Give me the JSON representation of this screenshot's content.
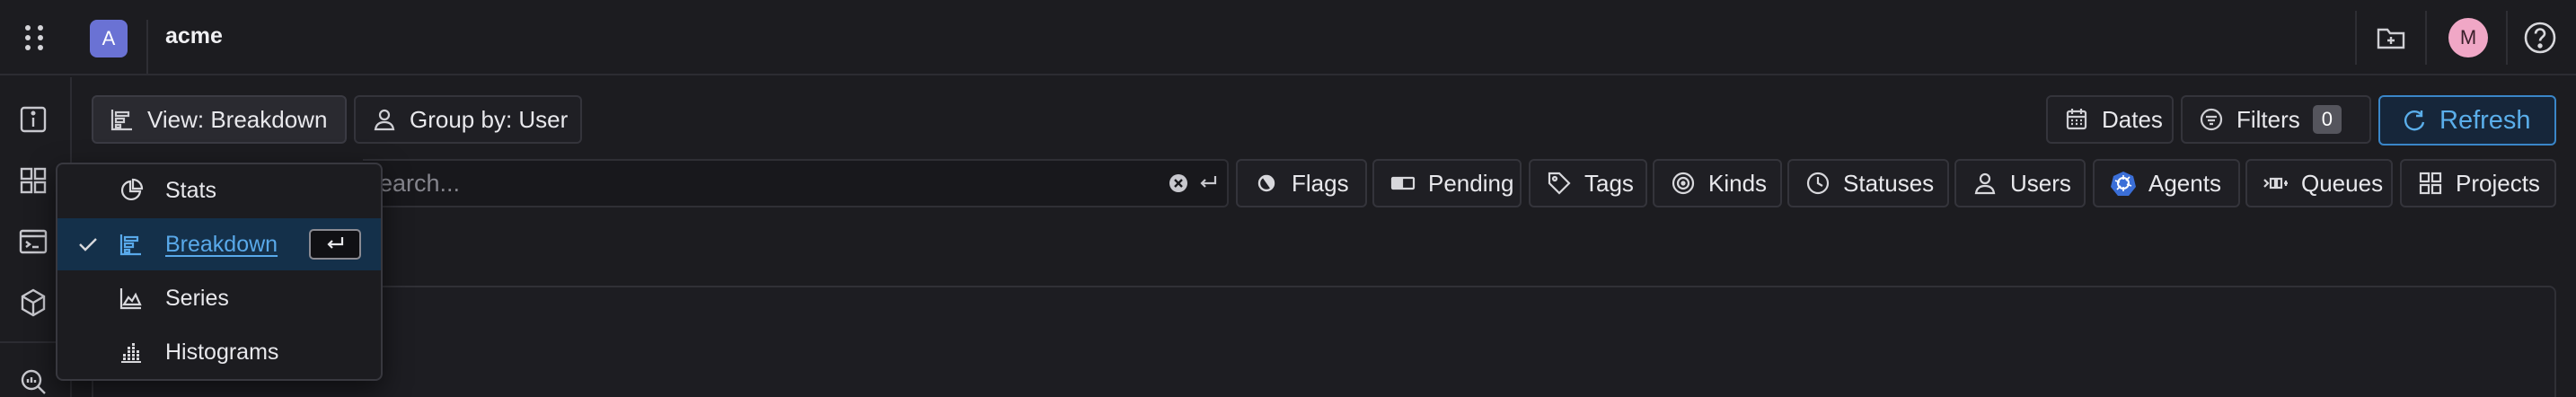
{
  "header": {
    "workspace_initial": "A",
    "workspace_name": "acme",
    "user_initial": "M"
  },
  "toolbar": {
    "view_label": "View: Breakdown",
    "group_label": "Group by: User",
    "dates_label": "Dates",
    "filters_label": "Filters",
    "filters_count": "0",
    "refresh_label": "Refresh"
  },
  "search": {
    "placeholder": "Search..."
  },
  "filter_chips": [
    {
      "label": "Flags",
      "icon": "flag-half-icon"
    },
    {
      "label": "Pending",
      "icon": "toggle-icon"
    },
    {
      "label": "Tags",
      "icon": "tag-icon"
    },
    {
      "label": "Kinds",
      "icon": "target-icon"
    },
    {
      "label": "Statuses",
      "icon": "clock-icon"
    },
    {
      "label": "Users",
      "icon": "user-icon"
    },
    {
      "label": "Agents",
      "icon": "kubernetes-icon"
    },
    {
      "label": "Queues",
      "icon": "queue-icon"
    },
    {
      "label": "Projects",
      "icon": "grid-icon"
    }
  ],
  "view_menu": {
    "items": [
      {
        "label": "Stats",
        "icon": "pie-chart-icon",
        "selected": false
      },
      {
        "label": "Breakdown",
        "icon": "breakdown-icon",
        "selected": true
      },
      {
        "label": "Series",
        "icon": "area-chart-icon",
        "selected": false
      },
      {
        "label": "Histograms",
        "icon": "histogram-icon",
        "selected": false
      }
    ]
  },
  "colors": {
    "background": "#1c1c20",
    "accent": "#59a9ea",
    "workspace_badge": "#6a72d4",
    "avatar": "#f0a7c6",
    "agents_icon": "#3b6fd8"
  }
}
